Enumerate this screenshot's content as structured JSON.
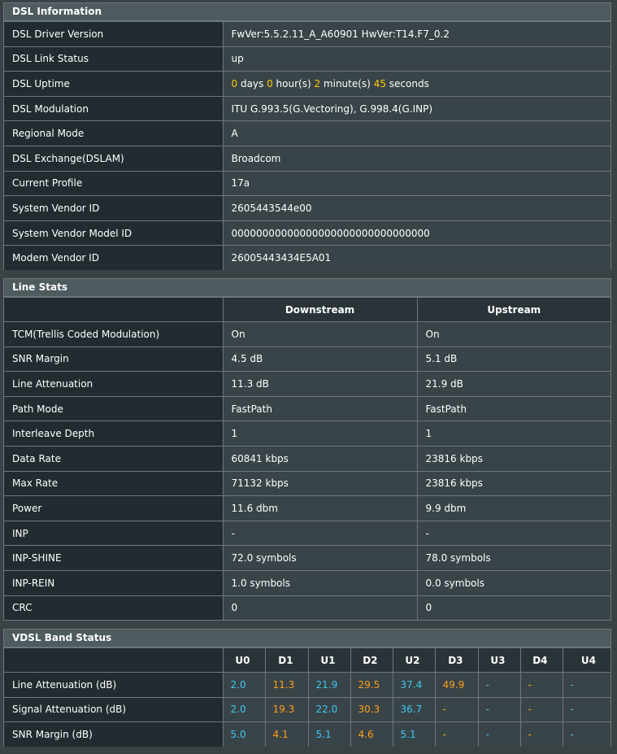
{
  "dsl_info": {
    "title": "DSL Information",
    "driver_version": {
      "label": "DSL Driver Version",
      "value": "FwVer:5.5.2.11_A_A60901 HwVer:T14.F7_0.2"
    },
    "link_status": {
      "label": "DSL Link Status",
      "value": "up"
    },
    "uptime": {
      "label": "DSL Uptime",
      "days": "0",
      "days_unit": " days ",
      "hours": "0",
      "hours_unit": " hour(s) ",
      "minutes": "2",
      "minutes_unit": " minute(s) ",
      "seconds": "45",
      "seconds_unit": " seconds"
    },
    "modulation": {
      "label": "DSL Modulation",
      "value": "ITU G.993.5(G.Vectoring), G.998.4(G.INP)"
    },
    "regional_mode": {
      "label": "Regional Mode",
      "value": "A"
    },
    "exchange": {
      "label": "DSL Exchange(DSLAM)",
      "value": "Broadcom"
    },
    "profile": {
      "label": "Current Profile",
      "value": "17a"
    },
    "vendor_id": {
      "label": "System Vendor ID",
      "value": "2605443544e00"
    },
    "vendor_model_id": {
      "label": "System Vendor Model ID",
      "value": "00000000000000000000000000000000"
    },
    "modem_vendor_id": {
      "label": "Modem Vendor ID",
      "value": "26005443434E5A01"
    }
  },
  "line_stats": {
    "title": "Line Stats",
    "col_downstream": "Downstream",
    "col_upstream": "Upstream",
    "tcm": {
      "label": "TCM(Trellis Coded Modulation)",
      "down": "On",
      "up": "On"
    },
    "snr_margin": {
      "label": "SNR Margin",
      "down": "4.5 dB",
      "up": "5.1 dB"
    },
    "line_attenuation": {
      "label": "Line Attenuation",
      "down": "11.3 dB",
      "up": "21.9 dB"
    },
    "path_mode": {
      "label": "Path Mode",
      "down": "FastPath",
      "up": "FastPath"
    },
    "interleave_depth": {
      "label": "Interleave Depth",
      "down": "1",
      "up": "1"
    },
    "data_rate": {
      "label": "Data Rate",
      "down": "60841 kbps",
      "up": "23816 kbps"
    },
    "max_rate": {
      "label": "Max Rate",
      "down": "71132 kbps",
      "up": "23816 kbps"
    },
    "power": {
      "label": "Power",
      "down": "11.6 dbm",
      "up": "9.9 dbm"
    },
    "inp": {
      "label": "INP",
      "down": "-",
      "up": "-"
    },
    "inp_shine": {
      "label": "INP-SHINE",
      "down": "72.0 symbols",
      "up": "78.0 symbols"
    },
    "inp_rein": {
      "label": "INP-REIN",
      "down": "1.0 symbols",
      "up": "0.0 symbols"
    },
    "crc": {
      "label": "CRC",
      "down": "0",
      "up": "0"
    }
  },
  "vdsl_band": {
    "title": "VDSL Band Status",
    "bands": [
      "U0",
      "D1",
      "U1",
      "D2",
      "U2",
      "D3",
      "U3",
      "D4",
      "U4"
    ],
    "colors": {
      "upstream": "#3cc8f0",
      "downstream": "#ff9f1a",
      "uptime_numbers": "#ffcc00"
    },
    "line_attenuation": {
      "label": "Line Attenuation (dB)",
      "values": [
        "2.0",
        "11.3",
        "21.9",
        "29.5",
        "37.4",
        "49.9",
        "-",
        "-",
        "-"
      ]
    },
    "signal_attenuation": {
      "label": "Signal Attenuation (dB)",
      "values": [
        "2.0",
        "19.3",
        "22.0",
        "30.3",
        "36.7",
        "-",
        "-",
        "-",
        "-"
      ]
    },
    "snr_margin": {
      "label": "SNR Margin (dB)",
      "values": [
        "5.0",
        "4.1",
        "5.1",
        "4.6",
        "5.1",
        "-",
        "-",
        "-",
        "-"
      ]
    }
  }
}
